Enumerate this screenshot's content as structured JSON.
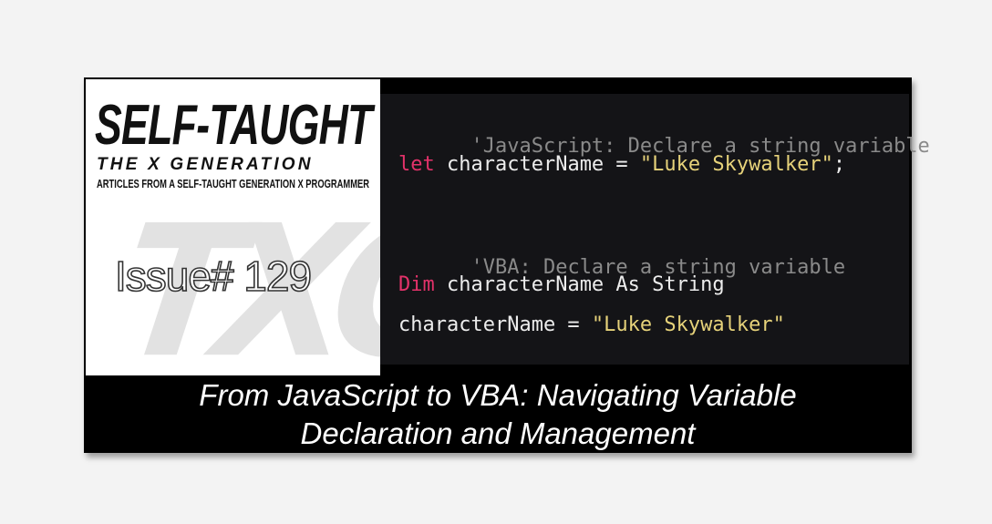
{
  "logo": {
    "title": "SELF-TAUGHT",
    "subtitle": "THE X GENERATION",
    "tagline": "ARTICLES FROM A SELF-TAUGHT GENERATION X PROGRAMMER",
    "watermark": "TXG",
    "issue": "Issue# 129"
  },
  "code": {
    "comment1": "'JavaScript: Declare a string variable",
    "line2_kw": "let",
    "line2_mid": " characterName = ",
    "line2_str": "\"Luke Skywalker\"",
    "line2_end": ";",
    "comment2": "'VBA: Declare a string variable",
    "line4_kw": "Dim",
    "line4_rest": " characterName As String",
    "line5_mid": "characterName = ",
    "line5_str": "\"Luke Skywalker\""
  },
  "caption": {
    "line1": "From JavaScript to VBA: Navigating Variable",
    "line2": "Declaration and Management"
  },
  "colors": {
    "background": "#f3f3f3",
    "card": "#000000",
    "code_background": "#141417",
    "keyword": "#e3326a",
    "string": "#e6d27a",
    "comment": "#8a8a8a"
  }
}
